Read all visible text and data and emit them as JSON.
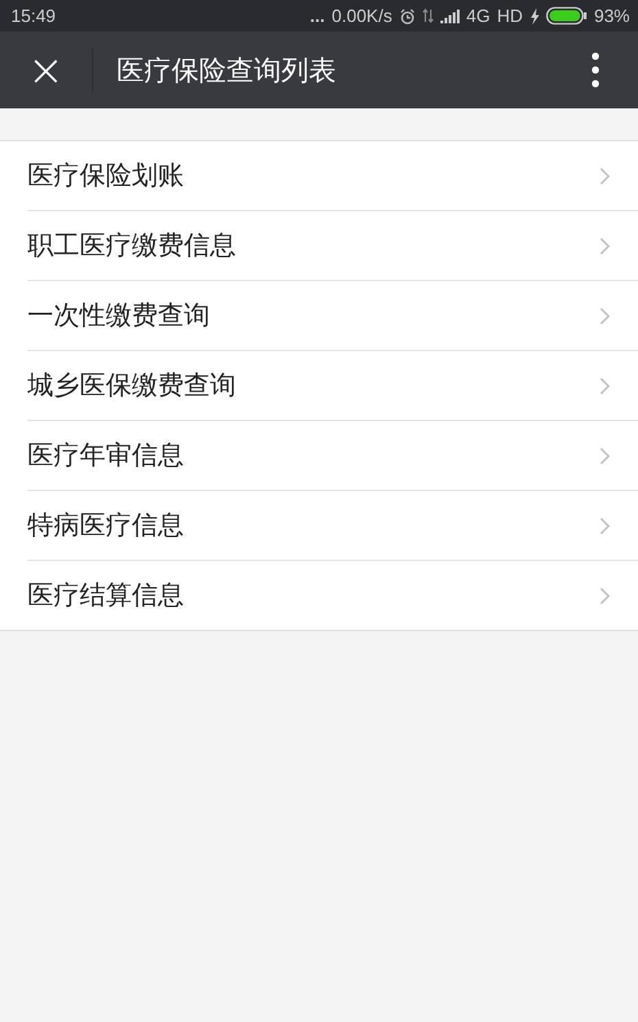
{
  "status_bar": {
    "time": "15:49",
    "more": "...",
    "speed": "0.00K/s",
    "network": "4G",
    "hd": "HD",
    "battery": "93%"
  },
  "nav_bar": {
    "close": "×",
    "title": "医疗保险查询列表"
  },
  "list": [
    {
      "label": "医疗保险划账"
    },
    {
      "label": "职工医疗缴费信息"
    },
    {
      "label": "一次性缴费查询"
    },
    {
      "label": "城乡医保缴费查询"
    },
    {
      "label": "医疗年审信息"
    },
    {
      "label": "特病医疗信息"
    },
    {
      "label": "医疗结算信息"
    }
  ]
}
